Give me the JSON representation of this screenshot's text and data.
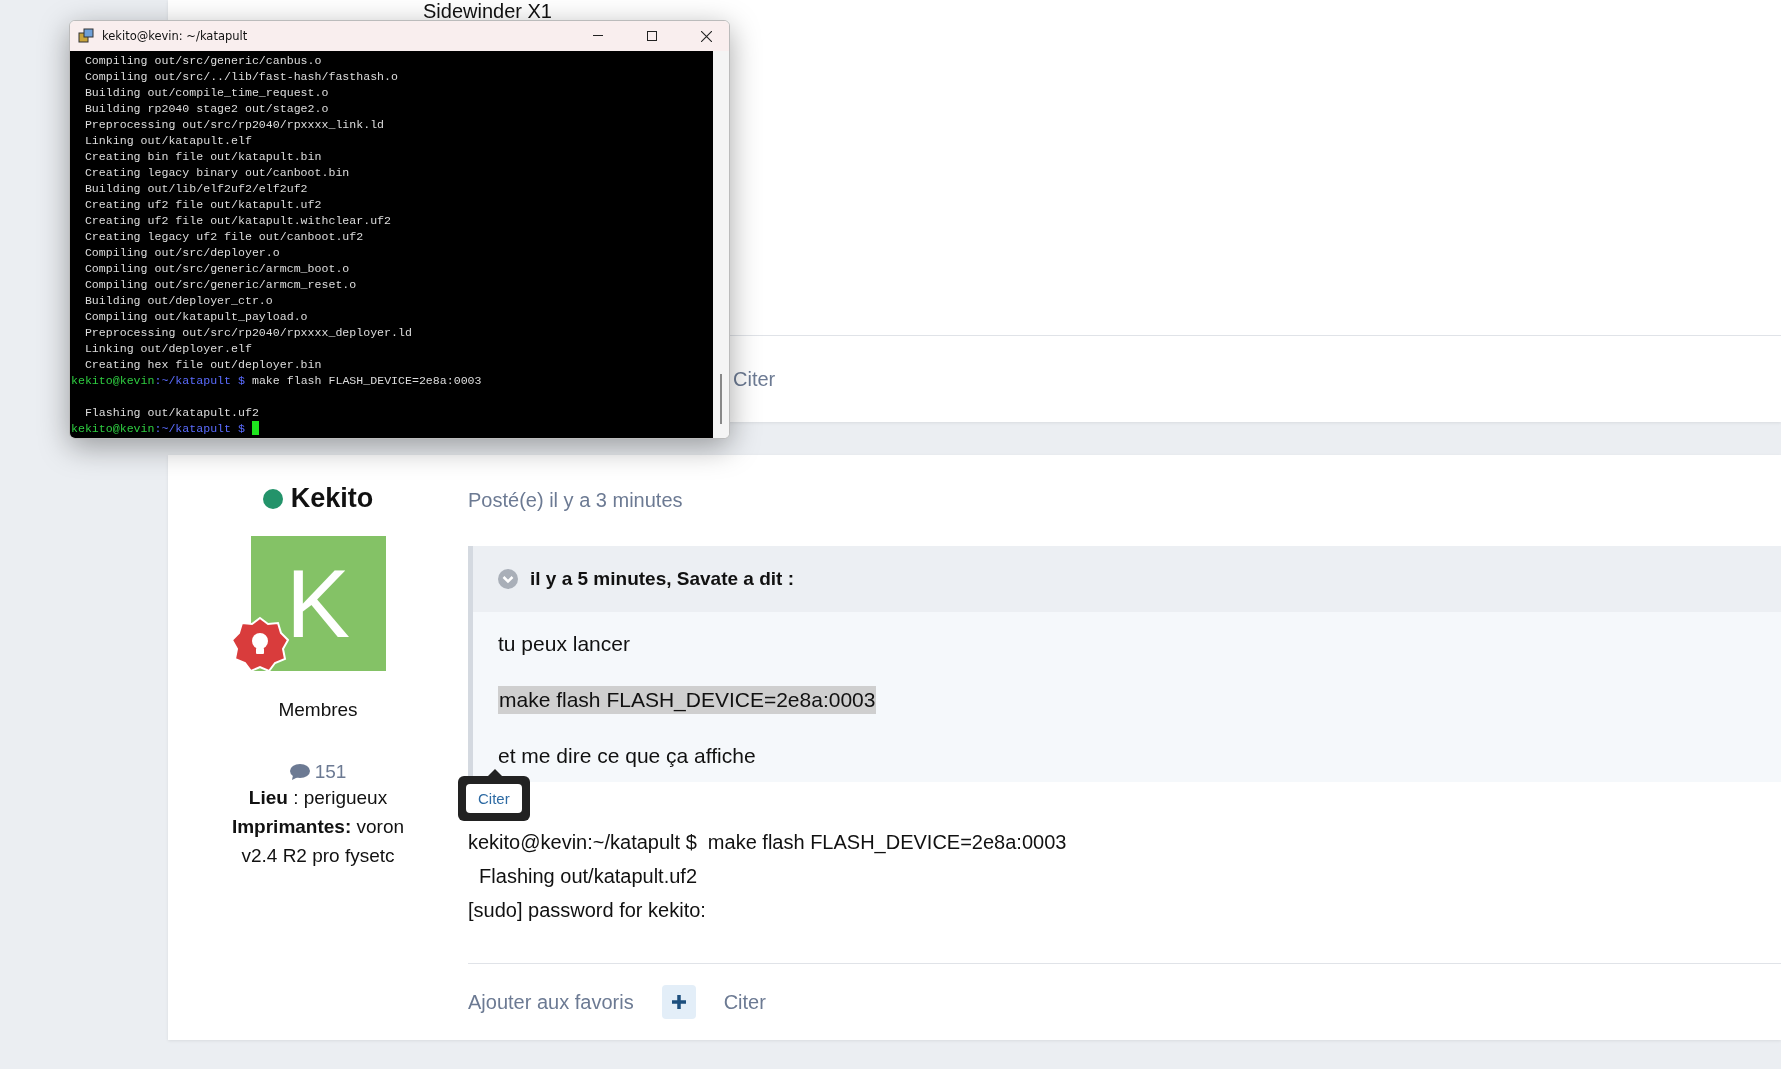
{
  "previous_post": {
    "text_lines": [
      "Sidewinder X1"
    ],
    "footer": {
      "quote_label": "Citer"
    }
  },
  "terminal": {
    "title": "kekito@kevin: ~/katapult",
    "lines": [
      {
        "kind": "output",
        "text": "  Compiling out/src/generic/canbus.o"
      },
      {
        "kind": "output",
        "text": "  Compiling out/src/../lib/fast-hash/fasthash.o"
      },
      {
        "kind": "output",
        "text": "  Building out/compile_time_request.o"
      },
      {
        "kind": "output",
        "text": "  Building rp2040 stage2 out/stage2.o"
      },
      {
        "kind": "output",
        "text": "  Preprocessing out/src/rp2040/rpxxxx_link.ld"
      },
      {
        "kind": "output",
        "text": "  Linking out/katapult.elf"
      },
      {
        "kind": "output",
        "text": "  Creating bin file out/katapult.bin"
      },
      {
        "kind": "output",
        "text": "  Creating legacy binary out/canboot.bin"
      },
      {
        "kind": "output",
        "text": "  Building out/lib/elf2uf2/elf2uf2"
      },
      {
        "kind": "output",
        "text": "  Creating uf2 file out/katapult.uf2"
      },
      {
        "kind": "output",
        "text": "  Creating uf2 file out/katapult.withclear.uf2"
      },
      {
        "kind": "output",
        "text": "  Creating legacy uf2 file out/canboot.uf2"
      },
      {
        "kind": "output",
        "text": "  Compiling out/src/deployer.o"
      },
      {
        "kind": "output",
        "text": "  Compiling out/src/generic/armcm_boot.o"
      },
      {
        "kind": "output",
        "text": "  Compiling out/src/generic/armcm_reset.o"
      },
      {
        "kind": "output",
        "text": "  Building out/deployer_ctr.o"
      },
      {
        "kind": "output",
        "text": "  Compiling out/katapult_payload.o"
      },
      {
        "kind": "output",
        "text": "  Preprocessing out/src/rp2040/rpxxxx_deployer.ld"
      },
      {
        "kind": "output",
        "text": "  Linking out/deployer.elf"
      },
      {
        "kind": "output",
        "text": "  Creating hex file out/deployer.bin"
      },
      {
        "kind": "prompt",
        "user": "kekito@kevin",
        "path": ":~/katapult",
        "symbol": "$",
        "command": "make flash FLASH_DEVICE=2e8a:0003"
      },
      {
        "kind": "blank"
      },
      {
        "kind": "output",
        "text": "  Flashing out/katapult.uf2"
      },
      {
        "kind": "prompt",
        "user": "kekito@kevin",
        "path": ":~/katapult",
        "symbol": "$",
        "cursor": true
      }
    ]
  },
  "post": {
    "author": {
      "name": "Kekito",
      "online": true,
      "avatar_letter": "K",
      "group": "Membres",
      "post_count": "151",
      "fields": [
        "**Lieu** : perigueux",
        "**Imprimantes:** voron v2.4 R2 pro fysetc"
      ]
    },
    "posted": "Posté(e) il y a 3 minutes",
    "quote": {
      "header": "il y a 5 minutes, Savate a dit :",
      "paragraphs": [
        {
          "kind": "text",
          "text": "tu peux lancer"
        },
        {
          "kind": "highlight",
          "text": "make flash FLASH_DEVICE=2e8a:0003"
        },
        {
          "kind": "text",
          "text": "et me dire ce que ça affiche"
        }
      ]
    },
    "tooltip": {
      "label": "Citer"
    },
    "body_lines": [
      "kekito@kevin:~/katapult $  make flash FLASH_DEVICE=2e8a:0003",
      "  Flashing out/katapult.uf2",
      "[sudo] password for kekito:"
    ],
    "footer": {
      "favorite_label": "Ajouter aux favoris",
      "quote_label": "Citer"
    }
  }
}
